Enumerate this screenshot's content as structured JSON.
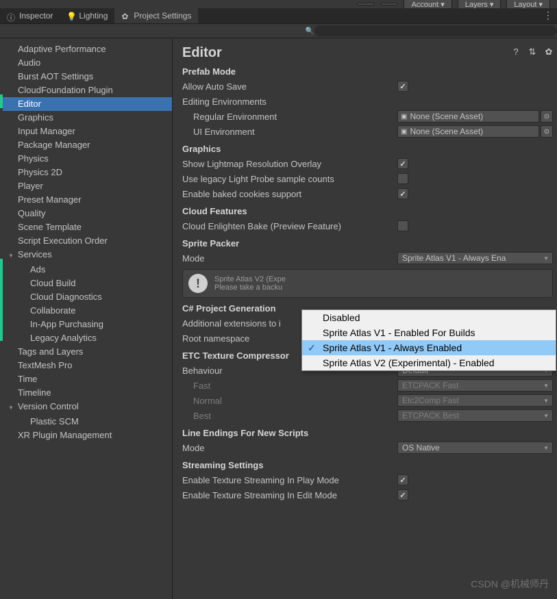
{
  "toolbar": {
    "account": "Account",
    "layers": "Layers",
    "layout": "Layout"
  },
  "tabs": [
    {
      "label": "Inspector",
      "icon": "info-icon"
    },
    {
      "label": "Lighting",
      "icon": "light-icon"
    },
    {
      "label": "Project Settings",
      "icon": "gear-icon",
      "active": true
    }
  ],
  "sidebar": {
    "items": [
      {
        "label": "Adaptive Performance"
      },
      {
        "label": "Audio"
      },
      {
        "label": "Burst AOT Settings"
      },
      {
        "label": "CloudFoundation Plugin"
      },
      {
        "label": "Editor",
        "selected": true
      },
      {
        "label": "Graphics"
      },
      {
        "label": "Input Manager"
      },
      {
        "label": "Package Manager"
      },
      {
        "label": "Physics"
      },
      {
        "label": "Physics 2D"
      },
      {
        "label": "Player"
      },
      {
        "label": "Preset Manager"
      },
      {
        "label": "Quality"
      },
      {
        "label": "Scene Template"
      },
      {
        "label": "Script Execution Order"
      },
      {
        "label": "Services",
        "expandable": true,
        "children": [
          {
            "label": "Ads"
          },
          {
            "label": "Cloud Build"
          },
          {
            "label": "Cloud Diagnostics"
          },
          {
            "label": "Collaborate"
          },
          {
            "label": "In-App Purchasing"
          },
          {
            "label": "Legacy Analytics"
          }
        ]
      },
      {
        "label": "Tags and Layers"
      },
      {
        "label": "TextMesh Pro"
      },
      {
        "label": "Time"
      },
      {
        "label": "Timeline"
      },
      {
        "label": "Version Control",
        "expandable": true,
        "children": [
          {
            "label": "Plastic SCM"
          }
        ]
      },
      {
        "label": "XR Plugin Management"
      }
    ]
  },
  "page": {
    "title": "Editor",
    "prefab_mode": {
      "heading": "Prefab Mode",
      "allow_auto_save": "Allow Auto Save",
      "editing_env": "Editing Environments",
      "regular_env": "Regular Environment",
      "ui_env": "UI Environment",
      "regular_val": "None (Scene Asset)",
      "ui_val": "None (Scene Asset)"
    },
    "graphics": {
      "heading": "Graphics",
      "lightmap": "Show Lightmap Resolution Overlay",
      "legacy_probe": "Use legacy Light Probe sample counts",
      "baked_cookies": "Enable baked cookies support"
    },
    "cloud": {
      "heading": "Cloud Features",
      "enlighten": "Cloud Enlighten Bake (Preview Feature)"
    },
    "sprite": {
      "heading": "Sprite Packer",
      "mode": "Mode",
      "mode_val": "Sprite Atlas V1 - Always Ena",
      "info1": "Sprite Atlas V2 (Expe",
      "info2": "Please take a backu"
    },
    "csharp": {
      "heading": "C# Project Generation",
      "additional": "Additional extensions to i",
      "root_ns": "Root namespace"
    },
    "etc": {
      "heading": "ETC Texture Compressor",
      "behaviour": "Behaviour",
      "behaviour_val": "Default",
      "fast": "Fast",
      "fast_val": "ETCPACK Fast",
      "normal": "Normal",
      "normal_val": "Etc2Comp Fast",
      "best": "Best",
      "best_val": "ETCPACK Best"
    },
    "lineend": {
      "heading": "Line Endings For New Scripts",
      "mode": "Mode",
      "mode_val": "OS Native"
    },
    "streaming": {
      "heading": "Streaming Settings",
      "play": "Enable Texture Streaming In Play Mode",
      "edit": "Enable Texture Streaming In Edit Mode"
    }
  },
  "popup": {
    "items": [
      {
        "label": "Disabled"
      },
      {
        "label": "Sprite Atlas V1 - Enabled For Builds"
      },
      {
        "label": "Sprite Atlas V1 - Always Enabled",
        "selected": true
      },
      {
        "label": "Sprite Atlas V2 (Experimental) - Enabled"
      }
    ]
  },
  "watermark": "CSDN @机械师丹"
}
